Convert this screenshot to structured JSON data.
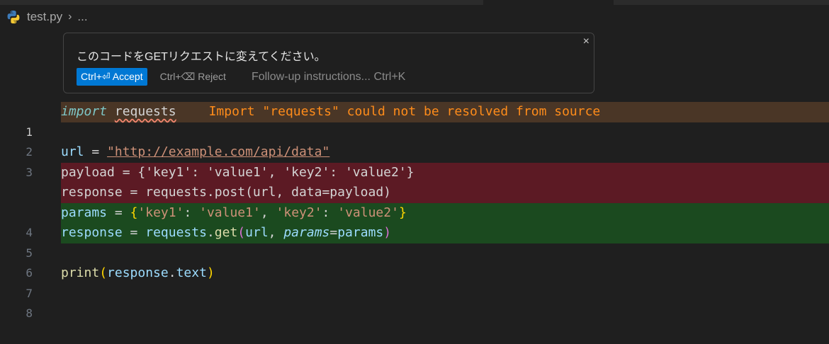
{
  "breadcrumb": {
    "file": "test.py",
    "rest": "..."
  },
  "inline_chat": {
    "prompt": "このコードをGETリクエストに変えてください。",
    "accept_label": "Ctrl+⏎ Accept",
    "reject_label": "Ctrl+⌫ Reject",
    "followup_placeholder": "Follow-up instructions... Ctrl+K",
    "close_icon": "×"
  },
  "editor": {
    "line_numbers": [
      "1",
      "2",
      "3",
      "4",
      "5",
      "6",
      "7",
      "8"
    ],
    "line1": {
      "kw": "import",
      "module": "requests",
      "diagnostic": "Import \"requests\" could not be resolved from source"
    },
    "line3": {
      "var": "url",
      "op": "=",
      "url": "\"http://example.com/api/data\""
    },
    "removed": [
      "payload = {'key1': 'value1', 'key2': 'value2'}",
      "response = requests.post(url, data=payload)"
    ],
    "line4": {
      "var": "params",
      "op": "=",
      "open": "{",
      "s1": "'key1'",
      "c1": ": ",
      "s2": "'value1'",
      "sep": ", ",
      "s3": "'key2'",
      "c2": ": ",
      "s4": "'value2'",
      "close": "}"
    },
    "line5": {
      "var": "response",
      "op": "=",
      "mod": "requests",
      "fn": "get",
      "open": "(",
      "arg1": "url",
      "comma": ", ",
      "kw": "params",
      "eq": "=",
      "val": "params",
      "close": ")"
    },
    "line7": {
      "fn": "print",
      "open": "(",
      "obj": "response",
      "attr": "text",
      "close": ")"
    }
  },
  "colors": {
    "warning_bg": "#4a3626",
    "removed_bg": "#5c1a24",
    "added_bg": "#1b4a1f",
    "accent": "#0078d4",
    "diagnostic": "#ff8c1a"
  }
}
